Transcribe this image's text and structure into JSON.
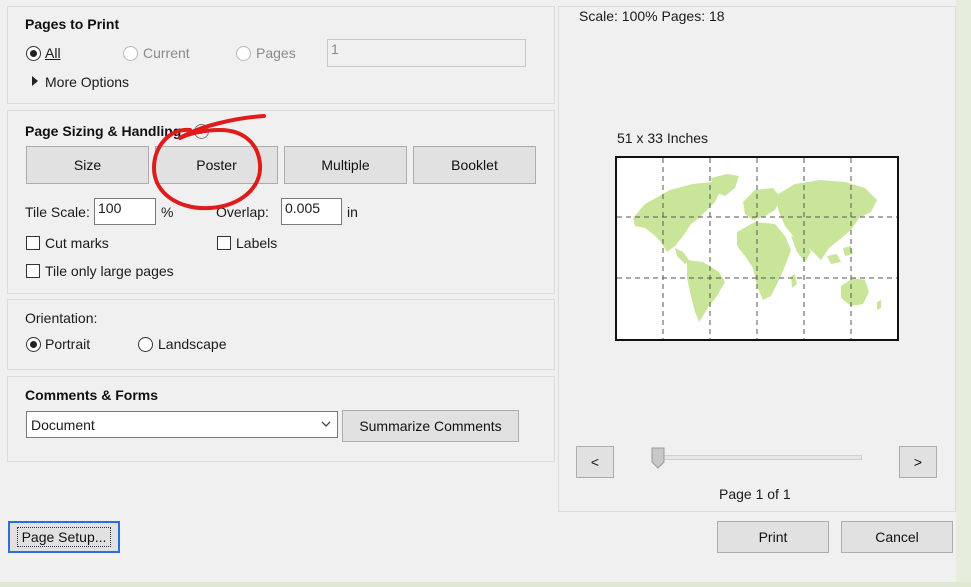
{
  "pages_to_print": {
    "title": "Pages to Print",
    "all_label": "All",
    "current_label": "Current",
    "pages_label": "Pages",
    "pages_value": "1",
    "more_options_label": "More Options"
  },
  "page_sizing": {
    "title": "Page Sizing & Handling",
    "tabs": [
      {
        "label": "Size"
      },
      {
        "label": "Poster"
      },
      {
        "label": "Multiple"
      },
      {
        "label": "Booklet"
      }
    ],
    "tile_scale_label": "Tile Scale:",
    "tile_scale_value": "100",
    "percent_label": "%",
    "overlap_label": "Overlap:",
    "overlap_value": "0.005",
    "unit_label": "in",
    "cut_marks_label": "Cut marks",
    "labels_label": "Labels",
    "tile_large_label": "Tile only large pages"
  },
  "orientation": {
    "title": "Orientation:",
    "portrait_label": "Portrait",
    "landscape_label": "Landscape"
  },
  "comments_forms": {
    "title": "Comments & Forms",
    "selected": "Document",
    "summarize_label": "Summarize Comments"
  },
  "preview": {
    "scale_text": "Scale: 100% Pages: 18",
    "size_text": "51 x 33 Inches",
    "prev_label": "<",
    "next_label": ">",
    "page_text": "Page 1 of 1"
  },
  "footer": {
    "page_setup_label": "Page Setup...",
    "print_label": "Print",
    "cancel_label": "Cancel"
  },
  "colors": {
    "map_land": "#c9e59a",
    "annotation_red": "#e01b1b",
    "focus_blue": "#2d6fd8"
  }
}
